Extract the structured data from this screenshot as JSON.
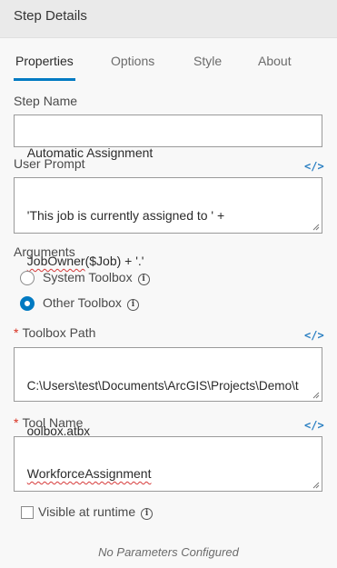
{
  "header": {
    "title": "Step Details"
  },
  "tabs": [
    {
      "label": "Properties",
      "active": true
    },
    {
      "label": "Options",
      "active": false
    },
    {
      "label": "Style",
      "active": false
    },
    {
      "label": "About",
      "active": false
    }
  ],
  "step_name": {
    "label": "Step Name",
    "value": "Automatic Assignment"
  },
  "user_prompt": {
    "label": "User Prompt",
    "value_line1": "'This job is currently assigned to ' +",
    "value_line2_prefix": "JobOwner",
    "value_line2_suffix": "($Job) + '.'",
    "code_icon": "</>"
  },
  "arguments": {
    "label": "Arguments",
    "options": [
      {
        "label": "System Toolbox",
        "selected": false
      },
      {
        "label": "Other Toolbox",
        "selected": true
      }
    ]
  },
  "toolbox_path": {
    "label": "Toolbox Path",
    "required_marker": "*",
    "value_line1": "C:\\Users\\test\\Documents\\ArcGIS\\Projects\\Demo\\t",
    "value_line2": "oolbox.atbx",
    "code_icon": "</>"
  },
  "tool_name": {
    "label": "Tool Name",
    "required_marker": "*",
    "value": "WorkforceAssignment",
    "code_icon": "</>"
  },
  "visible_at_runtime": {
    "label": "Visible at runtime",
    "checked": false
  },
  "footer": {
    "note": "No Parameters Configured"
  },
  "colors": {
    "accent": "#007ac2",
    "required": "#d83020",
    "header_bg": "#eaeaea"
  }
}
